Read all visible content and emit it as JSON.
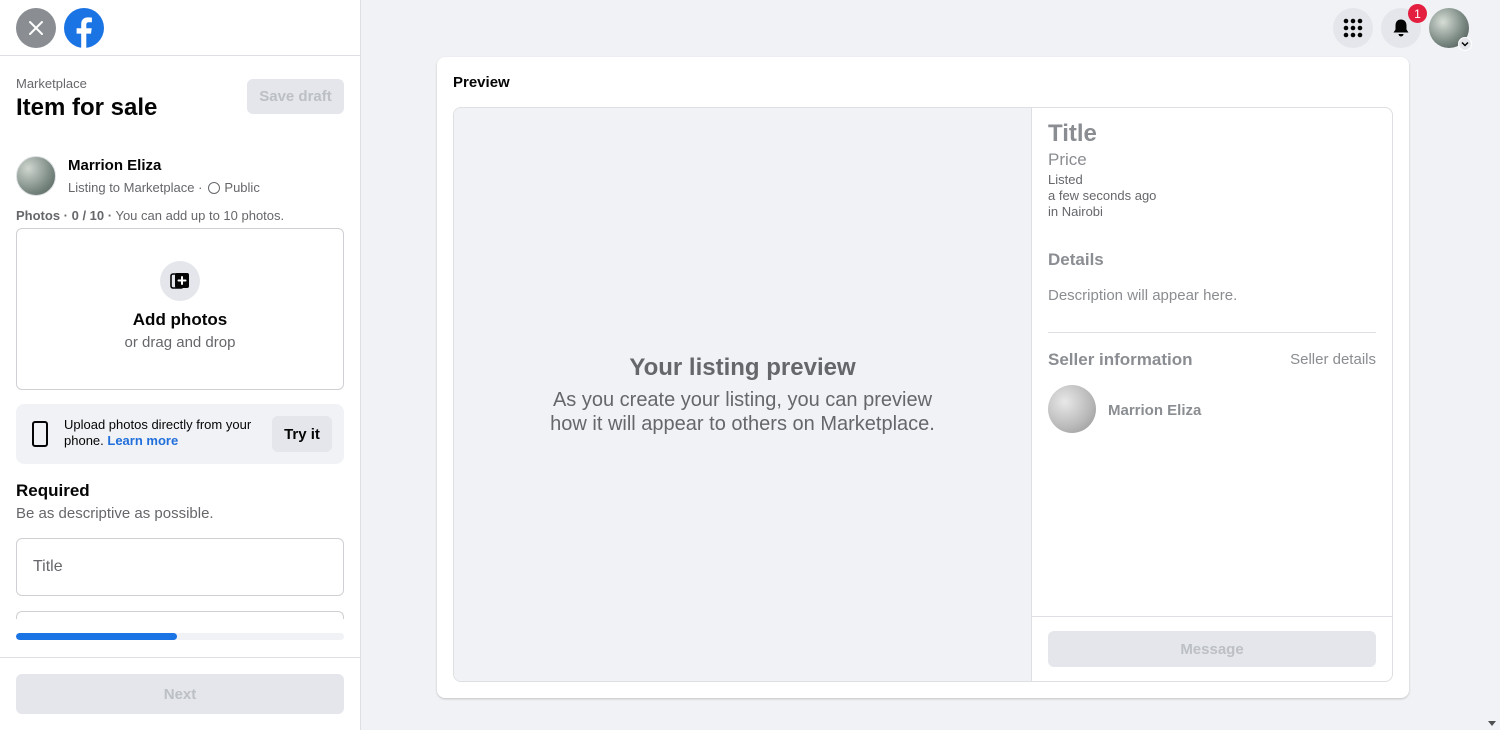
{
  "sidebar": {
    "breadcrumb": "Marketplace",
    "title": "Item for sale",
    "save_draft": "Save draft",
    "user": {
      "name": "Marrion Eliza",
      "listing_to": "Listing to Marketplace ·",
      "audience": "Public"
    },
    "photos": {
      "label": "Photos · 0 / 10 ·",
      "hint": "You can add up to 10 photos."
    },
    "dropzone": {
      "title": "Add photos",
      "subtitle": "or drag and drop"
    },
    "upload": {
      "text": "Upload photos directly from your phone.",
      "learn_more": "Learn more",
      "try_it": "Try it"
    },
    "required": {
      "title": "Required",
      "subtitle": "Be as descriptive as possible."
    },
    "title_input": {
      "placeholder": "Title",
      "value": ""
    },
    "progress": 0.49,
    "next": "Next"
  },
  "topbar": {
    "notification_count": "1"
  },
  "preview": {
    "label": "Preview",
    "placeholder_title": "Your listing preview",
    "placeholder_desc": "As you create your listing, you can preview how it will appear to others on Marketplace.",
    "title": "Title",
    "price": "Price",
    "listed": "Listed",
    "time": "a few seconds ago",
    "location": "in Nairobi",
    "details_heading": "Details",
    "description_placeholder": "Description will appear here.",
    "seller_heading": "Seller information",
    "seller_details": "Seller details",
    "seller_name": "Marrion Eliza",
    "message": "Message"
  },
  "colors": {
    "brand": "#1b74e4",
    "badge": "#e41e3f",
    "link": "#216fdb"
  }
}
